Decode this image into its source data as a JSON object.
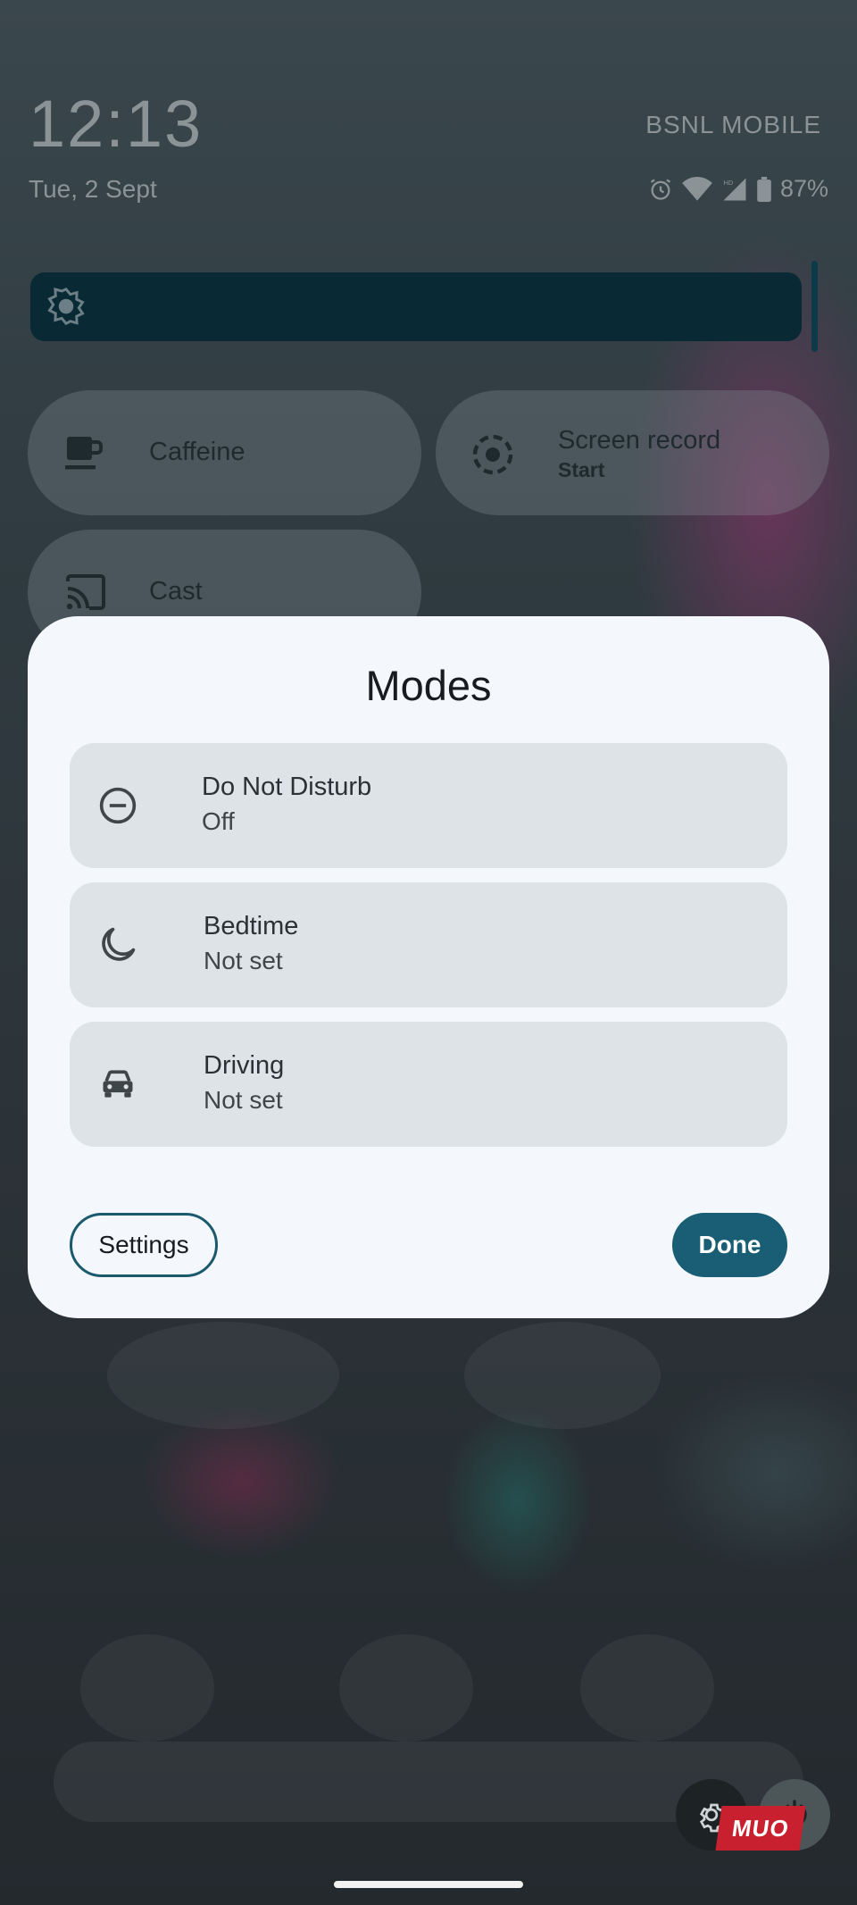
{
  "status": {
    "time": "12:13",
    "date": "Tue, 2 Sept",
    "carrier": "BSNL MOBILE",
    "battery": "87%",
    "icons": [
      "alarm-icon",
      "wifi-icon",
      "signal-icon",
      "battery-icon"
    ]
  },
  "quick_settings": {
    "brightness_icon": "brightness-icon",
    "tiles": [
      {
        "label": "Caffeine",
        "icon": "coffee-cup-icon"
      },
      {
        "label": "Screen record",
        "sub": "Start",
        "icon": "screen-record-icon"
      },
      {
        "label": "Cast",
        "icon": "cast-icon"
      }
    ]
  },
  "dialog": {
    "title": "Modes",
    "modes": [
      {
        "name": "Do Not Disturb",
        "status": "Off",
        "icon": "do-not-disturb-icon"
      },
      {
        "name": "Bedtime",
        "status": "Not set",
        "icon": "moon-icon"
      },
      {
        "name": "Driving",
        "status": "Not set",
        "icon": "car-icon"
      }
    ],
    "settings_label": "Settings",
    "done_label": "Done"
  },
  "watermark": "MUO",
  "colors": {
    "dialog_bg": "#f4f8fc",
    "mode_item_bg": "#dde3e7",
    "accent": "#195e74"
  }
}
